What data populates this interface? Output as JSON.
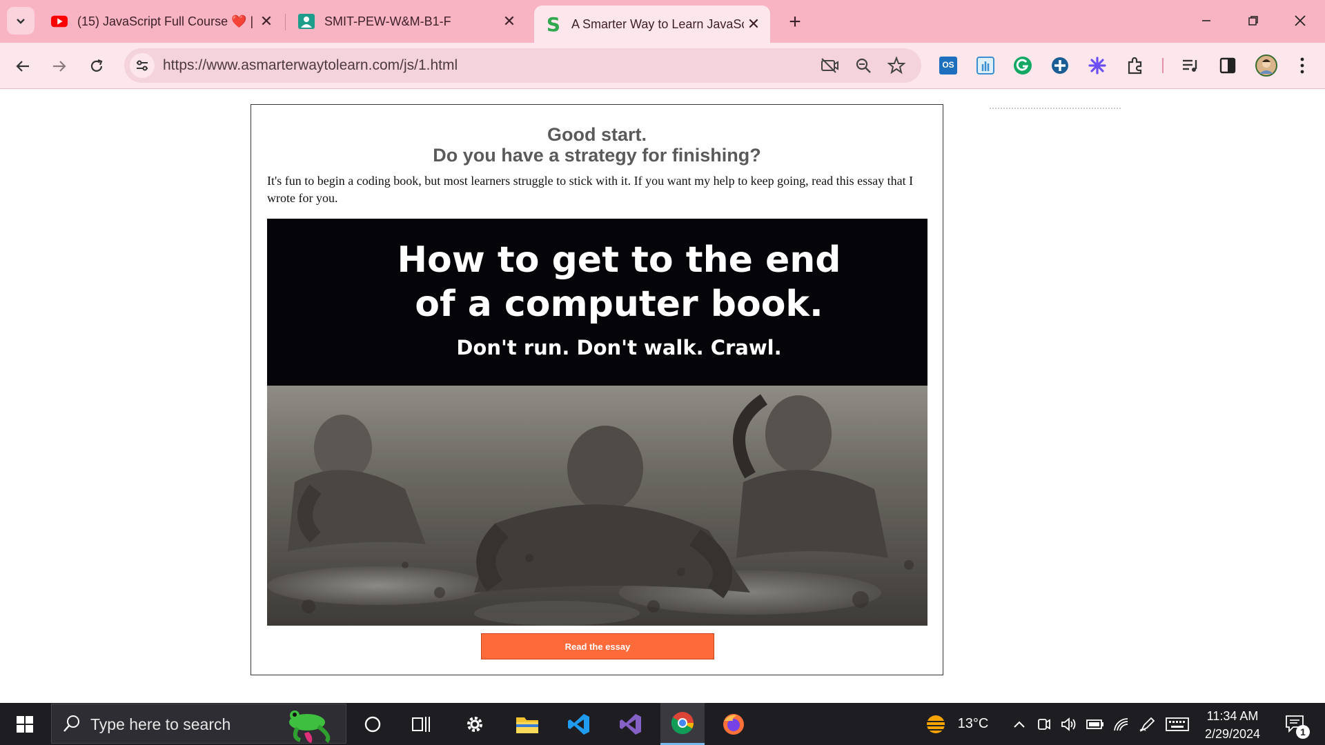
{
  "tabs": [
    {
      "title": "(15) JavaScript Full Course ❤️ |",
      "icon": "youtube-icon"
    },
    {
      "title": "SMIT-PEW-W&M-B1-F",
      "icon": "classroom-icon"
    },
    {
      "title": "A Smarter Way to Learn JavaScr",
      "icon": "smarter-way-s-icon",
      "favicon_letter": "S"
    }
  ],
  "toolbar": {
    "url": "https://www.asmarterwaytolearn.com/js/1.html"
  },
  "page": {
    "heading_line1": "Good start.",
    "heading_line2": "Do you have a strategy for finishing?",
    "intro": "It's fun to begin a coding book, but most learners struggle to stick with it. If you want my help to keep going, read this essay that I wrote for you.",
    "hero_title_line1": "How to get to the end",
    "hero_title_line2": "of a computer book.",
    "hero_subtitle": "Don't run. Don't walk. Crawl.",
    "cta_label": "Read the essay"
  },
  "taskbar": {
    "search_placeholder": "Type here to search",
    "temperature": "13°C",
    "time": "11:34 AM",
    "date": "2/29/2024",
    "notification_count": "1"
  },
  "colors": {
    "tabstrip": "#f8b4c3",
    "toolbar": "#fde7ec",
    "cta": "#ff6a3a",
    "taskbar": "#1e1d22"
  }
}
